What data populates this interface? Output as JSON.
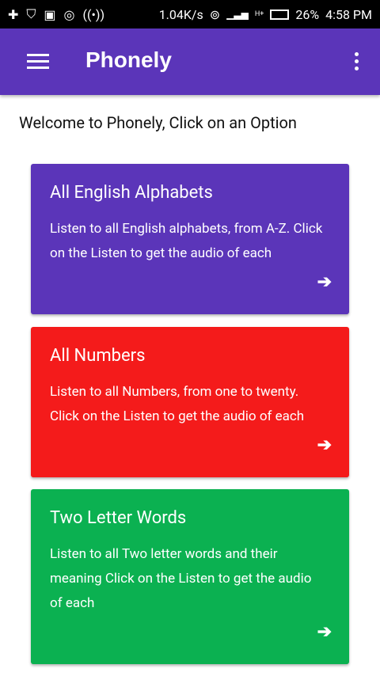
{
  "status_bar": {
    "speed": "1.04K/s",
    "battery": "26%",
    "time": "4:58 PM",
    "network": "H+"
  },
  "app_bar": {
    "title": "Phonely"
  },
  "welcome": "Welcome to Phonely, Click on an Option",
  "cards": [
    {
      "title": "All English Alphabets",
      "description": "Listen to all English alphabets, from A-Z. Click on the Listen to get the audio of each",
      "color": "#5b35b9"
    },
    {
      "title": "All Numbers",
      "description": "Listen to all Numbers, from one to twenty. Click on the Listen to get the audio of each",
      "color": "#f41b1b"
    },
    {
      "title": "Two Letter Words",
      "description": "Listen to all Two letter words and their meaning Click on the Listen to get the audio of each",
      "color": "#0bb151"
    }
  ]
}
